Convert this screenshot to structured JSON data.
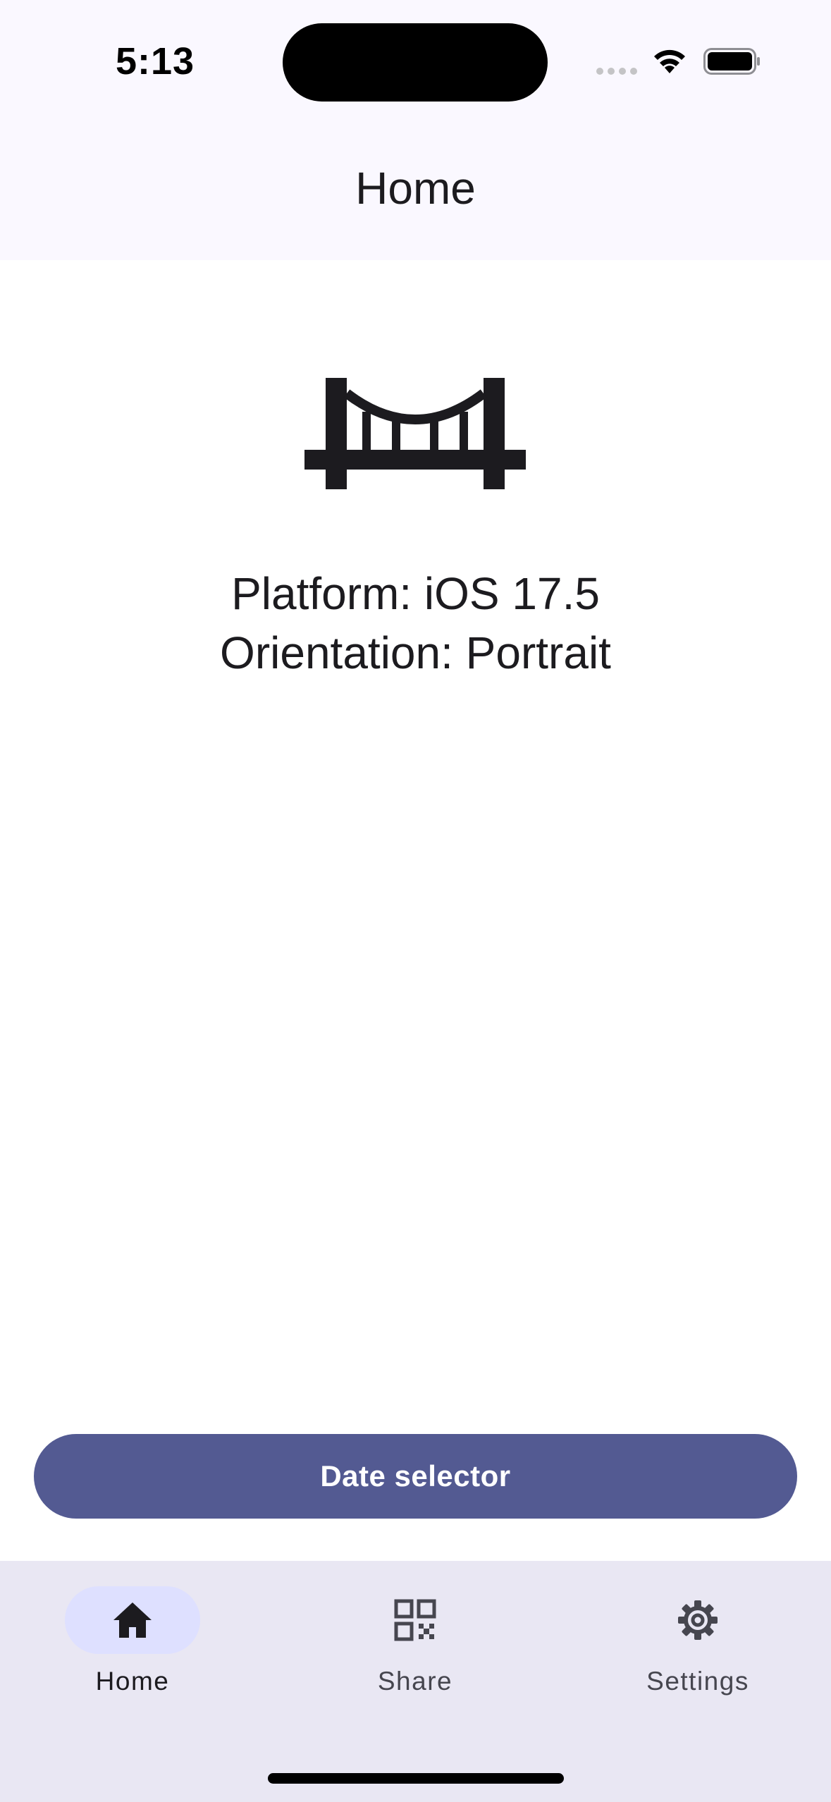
{
  "status_bar": {
    "time": "5:13"
  },
  "app_bar": {
    "title": "Home"
  },
  "main": {
    "hero_icon": "bridge-icon",
    "platform_text": "Platform: iOS 17.5",
    "orientation_text": "Orientation: Portrait",
    "date_button_label": "Date selector"
  },
  "nav": {
    "items": [
      {
        "label": "Home",
        "icon": "home-icon",
        "active": true
      },
      {
        "label": "Share",
        "icon": "qr-code-icon",
        "active": false
      },
      {
        "label": "Settings",
        "icon": "gear-icon",
        "active": false
      }
    ]
  },
  "colors": {
    "primary": "#535a92",
    "nav_background": "#e9e7f3",
    "nav_active_indicator": "#dee0ff",
    "app_bar_background": "#faf8ff"
  }
}
